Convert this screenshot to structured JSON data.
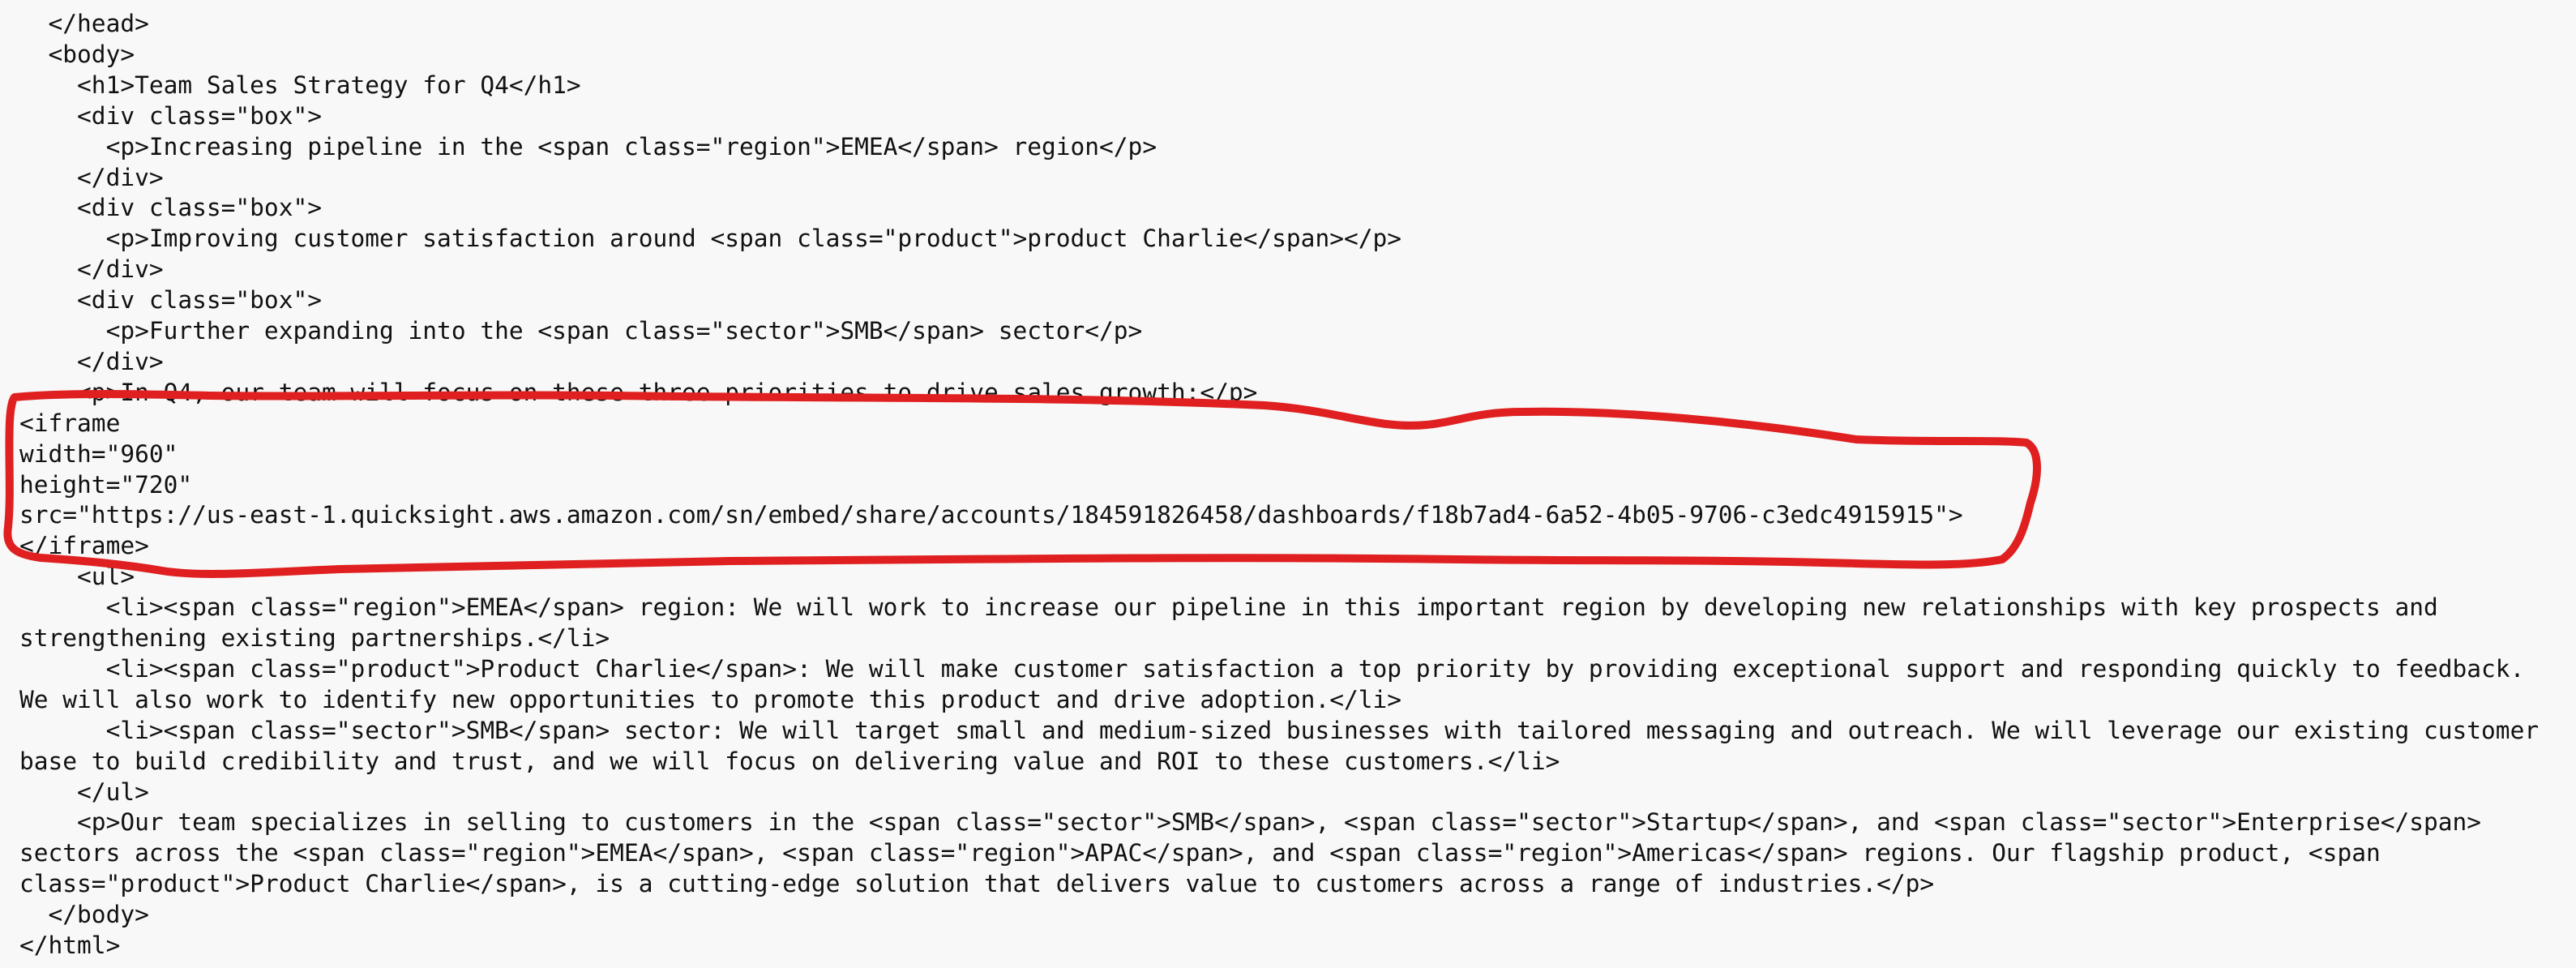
{
  "code_lines": [
    "  </head>",
    "  <body>",
    "    <h1>Team Sales Strategy for Q4</h1>",
    "    <div class=\"box\">",
    "      <p>Increasing pipeline in the <span class=\"region\">EMEA</span> region</p>",
    "    </div>",
    "    <div class=\"box\">",
    "      <p>Improving customer satisfaction around <span class=\"product\">product Charlie</span></p>",
    "    </div>",
    "    <div class=\"box\">",
    "      <p>Further expanding into the <span class=\"sector\">SMB</span> sector</p>",
    "    </div>",
    "    <p>In Q4, our team will focus on these three priorities to drive sales growth:</p>",
    "<iframe",
    "width=\"960\"",
    "height=\"720\"",
    "src=\"https://us-east-1.quicksight.aws.amazon.com/sn/embed/share/accounts/184591826458/dashboards/f18b7ad4-6a52-4b05-9706-c3edc4915915\">",
    "</iframe>",
    "    <ul>",
    "      <li><span class=\"region\">EMEA</span> region: We will work to increase our pipeline in this important region by developing new relationships with key prospects and",
    "strengthening existing partnerships.</li>",
    "      <li><span class=\"product\">Product Charlie</span>: We will make customer satisfaction a top priority by providing exceptional support and responding quickly to feedback.",
    "We will also work to identify new opportunities to promote this product and drive adoption.</li>",
    "      <li><span class=\"sector\">SMB</span> sector: We will target small and medium-sized businesses with tailored messaging and outreach. We will leverage our existing customer",
    "base to build credibility and trust, and we will focus on delivering value and ROI to these customers.</li>",
    "    </ul>",
    "    <p>Our team specializes in selling to customers in the <span class=\"sector\">SMB</span>, <span class=\"sector\">Startup</span>, and <span class=\"sector\">Enterprise</span>",
    "sectors across the <span class=\"region\">EMEA</span>, <span class=\"region\">APAC</span>, and <span class=\"region\">Americas</span> regions. Our flagship product, <span",
    "class=\"product\">Product Charlie</span>, is a cutting-edge solution that delivers value to customers across a range of industries.</p>",
    "  </body>",
    "</html>"
  ],
  "annotation_color": "#e02020"
}
